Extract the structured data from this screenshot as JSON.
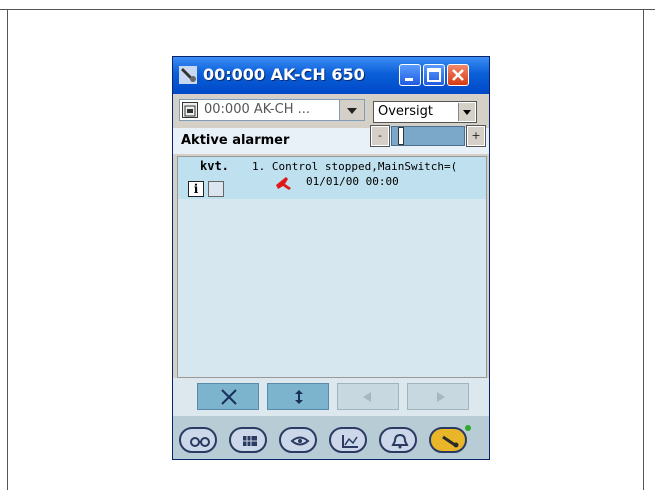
{
  "window": {
    "title": "00:000 AK-CH 650"
  },
  "toolbar": {
    "node_selector_value": "00:000 AK-CH ...",
    "view_selector_value": "Oversigt"
  },
  "panel": {
    "title": "Aktive alarmer",
    "zoom_minus": "-",
    "zoom_plus": "+"
  },
  "alarms": [
    {
      "ack_label": "kvt.",
      "text": "1. Control stopped,MainSwitch=(",
      "timestamp": "01/01/00 00:00",
      "info_label": "i"
    }
  ],
  "actions": {
    "icons": [
      "close-icon",
      "refresh-icon",
      "arrow-left-icon",
      "arrow-right-icon"
    ]
  },
  "tabs": {
    "icons": [
      "glasses-icon",
      "grid-icon",
      "eye-icon",
      "graph-icon",
      "bell-icon",
      "wrench-icon"
    ],
    "active_index": 5
  },
  "colors": {
    "titlebar": "#0a5fd8",
    "alarm_row": "#bfe0ee",
    "bell": "#e01818",
    "active_tab": "#e9b62a",
    "status_led": "#2faa2f"
  }
}
